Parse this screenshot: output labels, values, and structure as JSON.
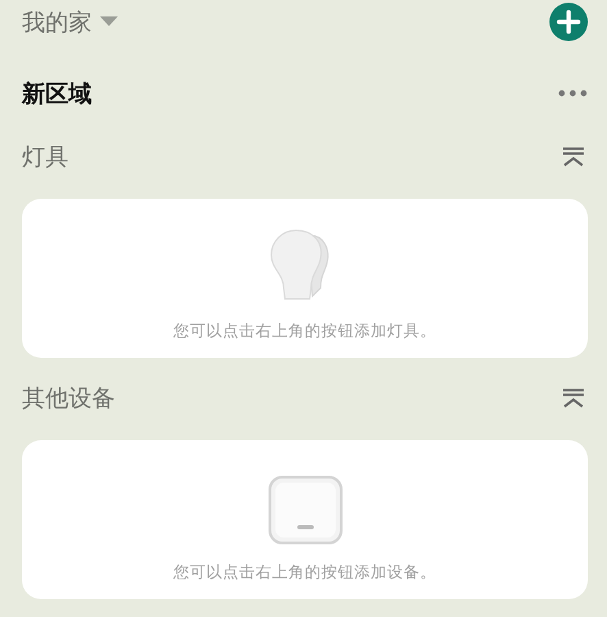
{
  "home": {
    "title": "我的家"
  },
  "area": {
    "title": "新区域"
  },
  "sections": [
    {
      "title": "灯具",
      "kind": "light",
      "expanded": true,
      "hint": "您可以点击右上角的按钮添加灯具。"
    },
    {
      "title": "其他设备",
      "kind": "switch",
      "expanded": true,
      "hint": "您可以点击右上角的按钮添加设备。"
    }
  ]
}
